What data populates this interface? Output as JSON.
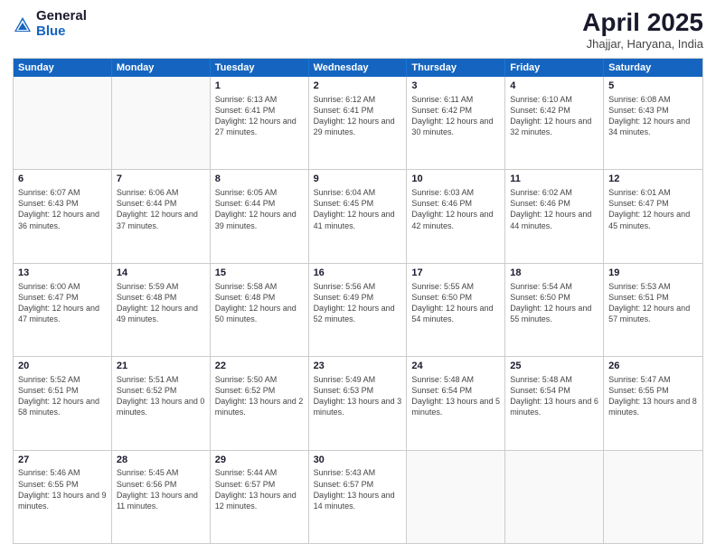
{
  "header": {
    "logo_general": "General",
    "logo_blue": "Blue",
    "month_title": "April 2025",
    "subtitle": "Jhajjar, Haryana, India"
  },
  "calendar": {
    "days": [
      "Sunday",
      "Monday",
      "Tuesday",
      "Wednesday",
      "Thursday",
      "Friday",
      "Saturday"
    ],
    "rows": [
      [
        {
          "day": "",
          "empty": true
        },
        {
          "day": "",
          "empty": true
        },
        {
          "day": "1",
          "sunrise": "Sunrise: 6:13 AM",
          "sunset": "Sunset: 6:41 PM",
          "daylight": "Daylight: 12 hours and 27 minutes."
        },
        {
          "day": "2",
          "sunrise": "Sunrise: 6:12 AM",
          "sunset": "Sunset: 6:41 PM",
          "daylight": "Daylight: 12 hours and 29 minutes."
        },
        {
          "day": "3",
          "sunrise": "Sunrise: 6:11 AM",
          "sunset": "Sunset: 6:42 PM",
          "daylight": "Daylight: 12 hours and 30 minutes."
        },
        {
          "day": "4",
          "sunrise": "Sunrise: 6:10 AM",
          "sunset": "Sunset: 6:42 PM",
          "daylight": "Daylight: 12 hours and 32 minutes."
        },
        {
          "day": "5",
          "sunrise": "Sunrise: 6:08 AM",
          "sunset": "Sunset: 6:43 PM",
          "daylight": "Daylight: 12 hours and 34 minutes."
        }
      ],
      [
        {
          "day": "6",
          "sunrise": "Sunrise: 6:07 AM",
          "sunset": "Sunset: 6:43 PM",
          "daylight": "Daylight: 12 hours and 36 minutes."
        },
        {
          "day": "7",
          "sunrise": "Sunrise: 6:06 AM",
          "sunset": "Sunset: 6:44 PM",
          "daylight": "Daylight: 12 hours and 37 minutes."
        },
        {
          "day": "8",
          "sunrise": "Sunrise: 6:05 AM",
          "sunset": "Sunset: 6:44 PM",
          "daylight": "Daylight: 12 hours and 39 minutes."
        },
        {
          "day": "9",
          "sunrise": "Sunrise: 6:04 AM",
          "sunset": "Sunset: 6:45 PM",
          "daylight": "Daylight: 12 hours and 41 minutes."
        },
        {
          "day": "10",
          "sunrise": "Sunrise: 6:03 AM",
          "sunset": "Sunset: 6:46 PM",
          "daylight": "Daylight: 12 hours and 42 minutes."
        },
        {
          "day": "11",
          "sunrise": "Sunrise: 6:02 AM",
          "sunset": "Sunset: 6:46 PM",
          "daylight": "Daylight: 12 hours and 44 minutes."
        },
        {
          "day": "12",
          "sunrise": "Sunrise: 6:01 AM",
          "sunset": "Sunset: 6:47 PM",
          "daylight": "Daylight: 12 hours and 45 minutes."
        }
      ],
      [
        {
          "day": "13",
          "sunrise": "Sunrise: 6:00 AM",
          "sunset": "Sunset: 6:47 PM",
          "daylight": "Daylight: 12 hours and 47 minutes."
        },
        {
          "day": "14",
          "sunrise": "Sunrise: 5:59 AM",
          "sunset": "Sunset: 6:48 PM",
          "daylight": "Daylight: 12 hours and 49 minutes."
        },
        {
          "day": "15",
          "sunrise": "Sunrise: 5:58 AM",
          "sunset": "Sunset: 6:48 PM",
          "daylight": "Daylight: 12 hours and 50 minutes."
        },
        {
          "day": "16",
          "sunrise": "Sunrise: 5:56 AM",
          "sunset": "Sunset: 6:49 PM",
          "daylight": "Daylight: 12 hours and 52 minutes."
        },
        {
          "day": "17",
          "sunrise": "Sunrise: 5:55 AM",
          "sunset": "Sunset: 6:50 PM",
          "daylight": "Daylight: 12 hours and 54 minutes."
        },
        {
          "day": "18",
          "sunrise": "Sunrise: 5:54 AM",
          "sunset": "Sunset: 6:50 PM",
          "daylight": "Daylight: 12 hours and 55 minutes."
        },
        {
          "day": "19",
          "sunrise": "Sunrise: 5:53 AM",
          "sunset": "Sunset: 6:51 PM",
          "daylight": "Daylight: 12 hours and 57 minutes."
        }
      ],
      [
        {
          "day": "20",
          "sunrise": "Sunrise: 5:52 AM",
          "sunset": "Sunset: 6:51 PM",
          "daylight": "Daylight: 12 hours and 58 minutes."
        },
        {
          "day": "21",
          "sunrise": "Sunrise: 5:51 AM",
          "sunset": "Sunset: 6:52 PM",
          "daylight": "Daylight: 13 hours and 0 minutes."
        },
        {
          "day": "22",
          "sunrise": "Sunrise: 5:50 AM",
          "sunset": "Sunset: 6:52 PM",
          "daylight": "Daylight: 13 hours and 2 minutes."
        },
        {
          "day": "23",
          "sunrise": "Sunrise: 5:49 AM",
          "sunset": "Sunset: 6:53 PM",
          "daylight": "Daylight: 13 hours and 3 minutes."
        },
        {
          "day": "24",
          "sunrise": "Sunrise: 5:48 AM",
          "sunset": "Sunset: 6:54 PM",
          "daylight": "Daylight: 13 hours and 5 minutes."
        },
        {
          "day": "25",
          "sunrise": "Sunrise: 5:48 AM",
          "sunset": "Sunset: 6:54 PM",
          "daylight": "Daylight: 13 hours and 6 minutes."
        },
        {
          "day": "26",
          "sunrise": "Sunrise: 5:47 AM",
          "sunset": "Sunset: 6:55 PM",
          "daylight": "Daylight: 13 hours and 8 minutes."
        }
      ],
      [
        {
          "day": "27",
          "sunrise": "Sunrise: 5:46 AM",
          "sunset": "Sunset: 6:55 PM",
          "daylight": "Daylight: 13 hours and 9 minutes."
        },
        {
          "day": "28",
          "sunrise": "Sunrise: 5:45 AM",
          "sunset": "Sunset: 6:56 PM",
          "daylight": "Daylight: 13 hours and 11 minutes."
        },
        {
          "day": "29",
          "sunrise": "Sunrise: 5:44 AM",
          "sunset": "Sunset: 6:57 PM",
          "daylight": "Daylight: 13 hours and 12 minutes."
        },
        {
          "day": "30",
          "sunrise": "Sunrise: 5:43 AM",
          "sunset": "Sunset: 6:57 PM",
          "daylight": "Daylight: 13 hours and 14 minutes."
        },
        {
          "day": "",
          "empty": true
        },
        {
          "day": "",
          "empty": true
        },
        {
          "day": "",
          "empty": true
        }
      ]
    ]
  }
}
